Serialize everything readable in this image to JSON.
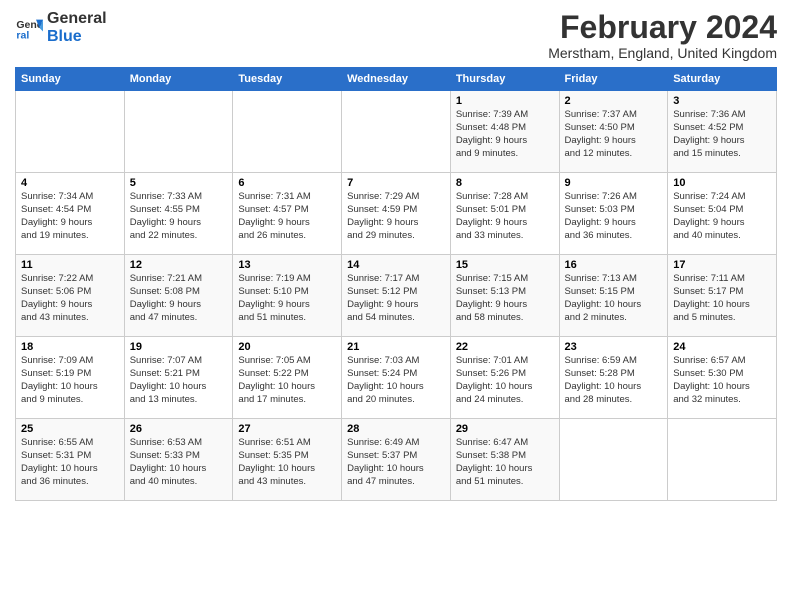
{
  "logo": {
    "line1": "General",
    "line2": "Blue"
  },
  "title": "February 2024",
  "subtitle": "Merstham, England, United Kingdom",
  "days_of_week": [
    "Sunday",
    "Monday",
    "Tuesday",
    "Wednesday",
    "Thursday",
    "Friday",
    "Saturday"
  ],
  "weeks": [
    [
      {
        "day": "",
        "info": ""
      },
      {
        "day": "",
        "info": ""
      },
      {
        "day": "",
        "info": ""
      },
      {
        "day": "",
        "info": ""
      },
      {
        "day": "1",
        "info": "Sunrise: 7:39 AM\nSunset: 4:48 PM\nDaylight: 9 hours\nand 9 minutes."
      },
      {
        "day": "2",
        "info": "Sunrise: 7:37 AM\nSunset: 4:50 PM\nDaylight: 9 hours\nand 12 minutes."
      },
      {
        "day": "3",
        "info": "Sunrise: 7:36 AM\nSunset: 4:52 PM\nDaylight: 9 hours\nand 15 minutes."
      }
    ],
    [
      {
        "day": "4",
        "info": "Sunrise: 7:34 AM\nSunset: 4:54 PM\nDaylight: 9 hours\nand 19 minutes."
      },
      {
        "day": "5",
        "info": "Sunrise: 7:33 AM\nSunset: 4:55 PM\nDaylight: 9 hours\nand 22 minutes."
      },
      {
        "day": "6",
        "info": "Sunrise: 7:31 AM\nSunset: 4:57 PM\nDaylight: 9 hours\nand 26 minutes."
      },
      {
        "day": "7",
        "info": "Sunrise: 7:29 AM\nSunset: 4:59 PM\nDaylight: 9 hours\nand 29 minutes."
      },
      {
        "day": "8",
        "info": "Sunrise: 7:28 AM\nSunset: 5:01 PM\nDaylight: 9 hours\nand 33 minutes."
      },
      {
        "day": "9",
        "info": "Sunrise: 7:26 AM\nSunset: 5:03 PM\nDaylight: 9 hours\nand 36 minutes."
      },
      {
        "day": "10",
        "info": "Sunrise: 7:24 AM\nSunset: 5:04 PM\nDaylight: 9 hours\nand 40 minutes."
      }
    ],
    [
      {
        "day": "11",
        "info": "Sunrise: 7:22 AM\nSunset: 5:06 PM\nDaylight: 9 hours\nand 43 minutes."
      },
      {
        "day": "12",
        "info": "Sunrise: 7:21 AM\nSunset: 5:08 PM\nDaylight: 9 hours\nand 47 minutes."
      },
      {
        "day": "13",
        "info": "Sunrise: 7:19 AM\nSunset: 5:10 PM\nDaylight: 9 hours\nand 51 minutes."
      },
      {
        "day": "14",
        "info": "Sunrise: 7:17 AM\nSunset: 5:12 PM\nDaylight: 9 hours\nand 54 minutes."
      },
      {
        "day": "15",
        "info": "Sunrise: 7:15 AM\nSunset: 5:13 PM\nDaylight: 9 hours\nand 58 minutes."
      },
      {
        "day": "16",
        "info": "Sunrise: 7:13 AM\nSunset: 5:15 PM\nDaylight: 10 hours\nand 2 minutes."
      },
      {
        "day": "17",
        "info": "Sunrise: 7:11 AM\nSunset: 5:17 PM\nDaylight: 10 hours\nand 5 minutes."
      }
    ],
    [
      {
        "day": "18",
        "info": "Sunrise: 7:09 AM\nSunset: 5:19 PM\nDaylight: 10 hours\nand 9 minutes."
      },
      {
        "day": "19",
        "info": "Sunrise: 7:07 AM\nSunset: 5:21 PM\nDaylight: 10 hours\nand 13 minutes."
      },
      {
        "day": "20",
        "info": "Sunrise: 7:05 AM\nSunset: 5:22 PM\nDaylight: 10 hours\nand 17 minutes."
      },
      {
        "day": "21",
        "info": "Sunrise: 7:03 AM\nSunset: 5:24 PM\nDaylight: 10 hours\nand 20 minutes."
      },
      {
        "day": "22",
        "info": "Sunrise: 7:01 AM\nSunset: 5:26 PM\nDaylight: 10 hours\nand 24 minutes."
      },
      {
        "day": "23",
        "info": "Sunrise: 6:59 AM\nSunset: 5:28 PM\nDaylight: 10 hours\nand 28 minutes."
      },
      {
        "day": "24",
        "info": "Sunrise: 6:57 AM\nSunset: 5:30 PM\nDaylight: 10 hours\nand 32 minutes."
      }
    ],
    [
      {
        "day": "25",
        "info": "Sunrise: 6:55 AM\nSunset: 5:31 PM\nDaylight: 10 hours\nand 36 minutes."
      },
      {
        "day": "26",
        "info": "Sunrise: 6:53 AM\nSunset: 5:33 PM\nDaylight: 10 hours\nand 40 minutes."
      },
      {
        "day": "27",
        "info": "Sunrise: 6:51 AM\nSunset: 5:35 PM\nDaylight: 10 hours\nand 43 minutes."
      },
      {
        "day": "28",
        "info": "Sunrise: 6:49 AM\nSunset: 5:37 PM\nDaylight: 10 hours\nand 47 minutes."
      },
      {
        "day": "29",
        "info": "Sunrise: 6:47 AM\nSunset: 5:38 PM\nDaylight: 10 hours\nand 51 minutes."
      },
      {
        "day": "",
        "info": ""
      },
      {
        "day": "",
        "info": ""
      }
    ]
  ]
}
